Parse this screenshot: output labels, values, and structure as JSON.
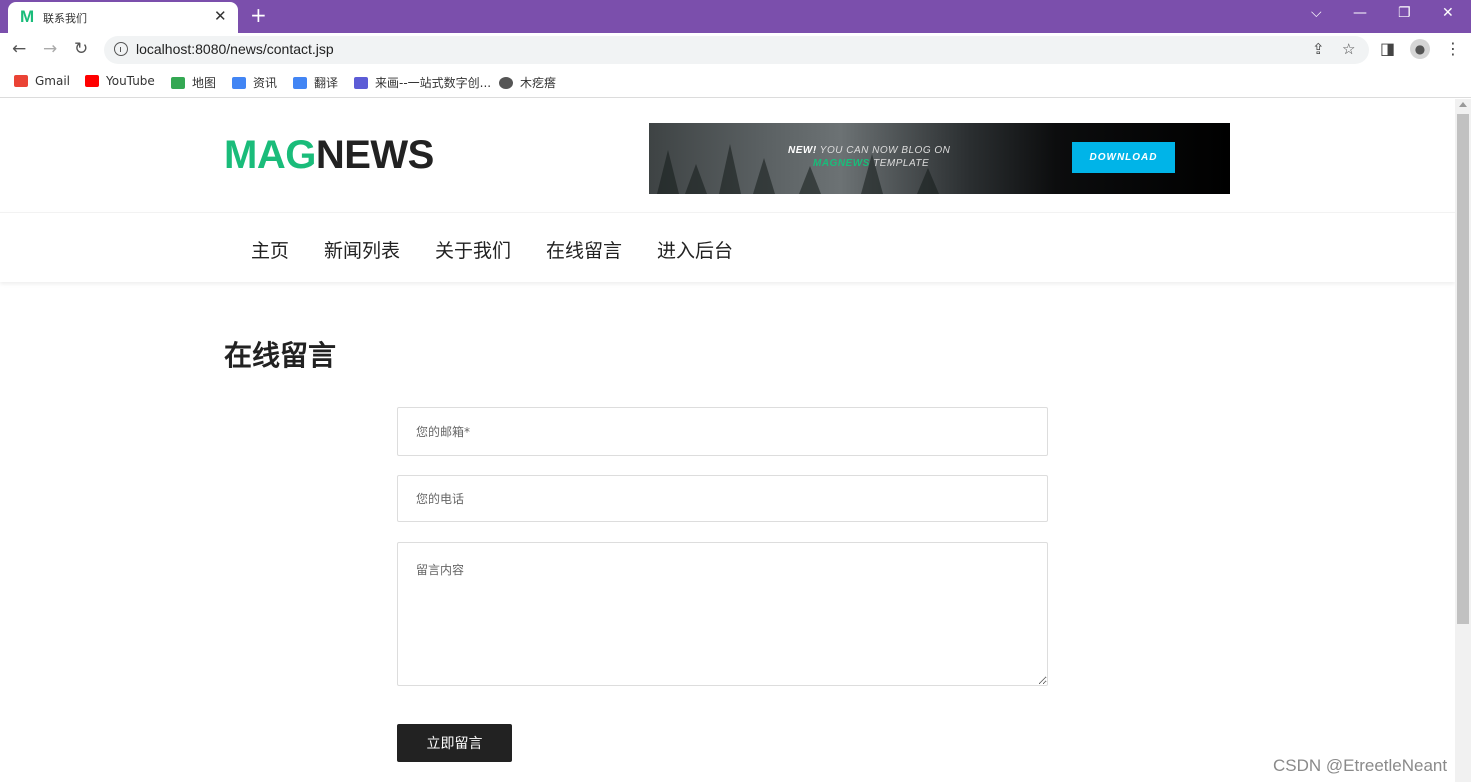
{
  "browser": {
    "tab": {
      "favicon": "M",
      "title": "联系我们",
      "close": "✕"
    },
    "new_tab": "+",
    "window_controls": {
      "dropdown": "⌵",
      "minimize": "—",
      "restore": "❐",
      "close": "✕"
    },
    "nav": {
      "back": "←",
      "forward": "→",
      "reload": "↻"
    },
    "url": "localhost:8080/news/contact.jsp",
    "bookmarks": [
      {
        "label": "Gmail",
        "color": "#ea4335"
      },
      {
        "label": "YouTube",
        "color": "#ff0000"
      },
      {
        "label": "地图",
        "color": "#34a853"
      },
      {
        "label": "资讯",
        "color": "#4285f4"
      },
      {
        "label": "翻译",
        "color": "#4285f4"
      },
      {
        "label": "来画--一站式数字创...",
        "color": "#5c5cd6"
      },
      {
        "label": "木疙瘩",
        "color": "#555555"
      }
    ]
  },
  "site": {
    "logo": {
      "part1": "MAG",
      "part2": "NEWS"
    },
    "banner": {
      "line1_bold": "NEW!",
      "line1_rest": " YOU CAN NOW BLOG ON",
      "line2_brand": "MAGNEWS",
      "line2_rest": " TEMPLATE",
      "button": "DOWNLOAD"
    },
    "menu": [
      "主页",
      "新闻列表",
      "关于我们",
      "在线留言",
      "进入后台"
    ]
  },
  "contact": {
    "title": "在线留言",
    "email_placeholder": "您的邮箱*",
    "phone_placeholder": "您的电话",
    "message_placeholder": "留言内容",
    "submit_label": "立即留言"
  },
  "watermark": "CSDN @EtreetleNeant",
  "colors": {
    "brand_green": "#1abc7a",
    "tab_bar": "#7b4fac",
    "banner_button": "#00b4e8",
    "submit_button": "#222222"
  }
}
